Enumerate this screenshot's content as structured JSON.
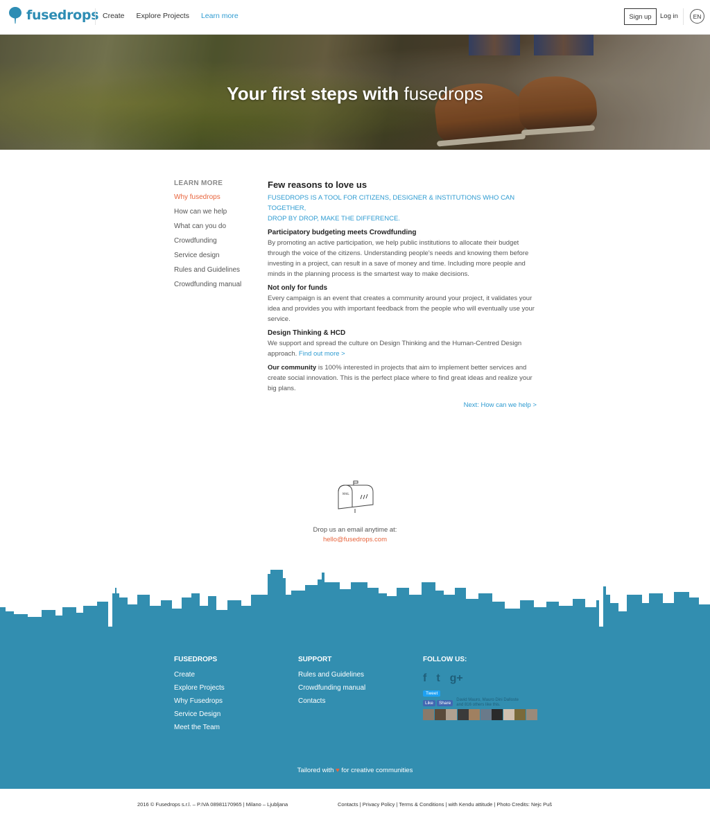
{
  "header": {
    "logo_text": "fusedrops",
    "nav": [
      "Create",
      "Explore Projects",
      "Learn more"
    ],
    "signup": "Sign up",
    "login": "Log in",
    "lang": "EN"
  },
  "hero": {
    "title_bold": "Your first steps with",
    "title_light": "fusedrops"
  },
  "sidebar": {
    "title": "LEARN MORE",
    "items": [
      "Why fusedrops",
      "How can we help",
      "What can you do",
      "Crowdfunding",
      "Service design",
      "Rules and Guidelines",
      "Crowdfunding manual"
    ]
  },
  "content": {
    "heading": "Few reasons to love us",
    "tagline_1": "FUSEDROPS IS A TOOL FOR CITIZENS, DESIGNER & INSTITUTIONS WHO CAN TOGETHER,",
    "tagline_2": "DROP BY DROP, MAKE THE DIFFERENCE.",
    "s1_title": "Participatory budgeting meets Crowdfunding",
    "s1_text": "By promoting an active participation, we help public institutions to allocate their budget through the voice of the citizens. Understanding people's needs and knowing them before investing in a project, can result in a save of money and time. Including more people and minds in the planning process is the smartest way to make decisions.",
    "s2_title": "Not only for funds",
    "s2_text": "Every campaign is an event that creates a community around your project, it validates your idea and provides you with important feedback from the people who will eventually use your service.",
    "s3_title": "Design Thinking & HCD",
    "s3_text": "We support and spread the culture on Design Thinking and the Human-Centred Design approach.",
    "s3_link": "Find out more >",
    "s4_bold": "Our community",
    "s4_text": " is 100% interested in projects that aim to implement better services and create social innovation. This is the perfect place where to find great ideas and realize your big plans.",
    "next": "Next: How can we help >"
  },
  "mail": {
    "icon": "mailbox-icon",
    "text": "Drop us an email anytime at:",
    "email": "hello@fusedrops.com"
  },
  "footer": {
    "col1_title": "FUSEDROPS",
    "col1": [
      "Create",
      "Explore Projects",
      "Why Fusedrops",
      "Service Design",
      "Meet the Team"
    ],
    "col2_title": "SUPPORT",
    "col2": [
      "Rules and Guidelines",
      "Crowdfunding manual",
      "Contacts"
    ],
    "col3_title": "FOLLOW US:",
    "social_icons": [
      "facebook-icon",
      "twitter-icon",
      "google-plus-icon"
    ],
    "social_glyphs": [
      "f",
      "t",
      "g+"
    ],
    "tweet": "Tweet",
    "fb_like": "Like",
    "fb_share": "Share",
    "fb_text_1": "David Mauro, Mauro Dini Dalloste",
    "fb_text_2": "and 816 others like this.",
    "tailored_before": "Tailored with",
    "tailored_heart": "♥",
    "tailored_after": "for creative communities",
    "color": "#328eb0"
  },
  "bottom": {
    "left": "2016 © Fusedrops s.r.l. – P.IVA 08981170965  |  Milano – Ljubljana",
    "right": "Contacts  |  Privacy Policy  |  Terms & Conditions  |  with Kendu attitude  |  Photo Credits: Nejc Puš"
  },
  "colors": {
    "brand": "#2e8db4",
    "accent": "#e8643c",
    "link": "#2e9bd1"
  }
}
